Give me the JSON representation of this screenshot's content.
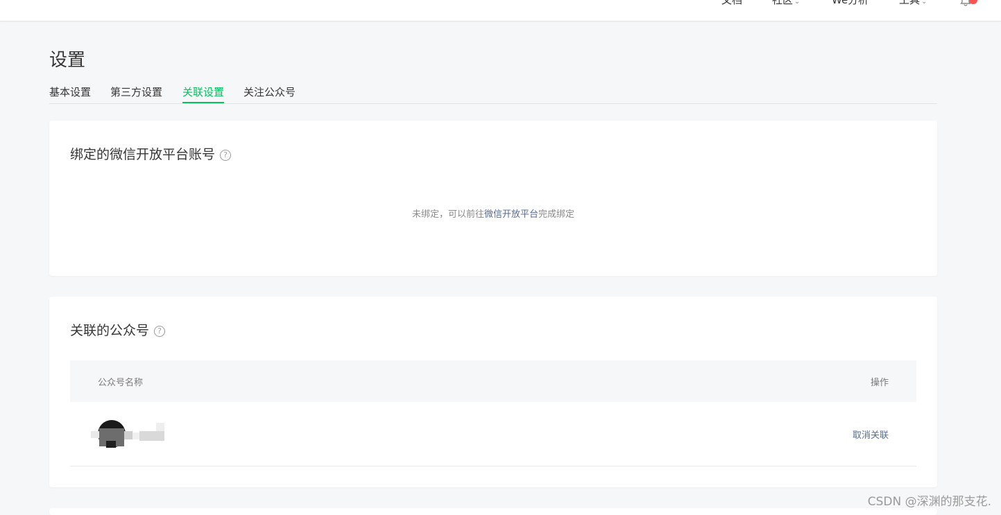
{
  "topnav": {
    "items": [
      {
        "label": "文档",
        "has_dropdown": false
      },
      {
        "label": "社区",
        "has_dropdown": true
      },
      {
        "label": "We分析",
        "has_dropdown": false
      },
      {
        "label": "工具",
        "has_dropdown": true
      }
    ],
    "dropdown_glyph": "⌄",
    "notification_icon": "bell-icon"
  },
  "page": {
    "title": "设置"
  },
  "tabs": [
    {
      "label": "基本设置",
      "active": false
    },
    {
      "label": "第三方设置",
      "active": false
    },
    {
      "label": "关联设置",
      "active": true
    },
    {
      "label": "关注公众号",
      "active": false
    }
  ],
  "open_platform_card": {
    "title": "绑定的微信开放平台账号",
    "help_glyph": "?",
    "note_prefix": "未绑定，可以前往",
    "note_link": "微信开放平台",
    "note_suffix": "完成绑定"
  },
  "official_accounts_card": {
    "title": "关联的公众号",
    "help_glyph": "?",
    "columns": {
      "name": "公众号名称",
      "action": "操作"
    },
    "rows": [
      {
        "action_label": "取消关联"
      }
    ]
  },
  "watermark": "CSDN @深渊的那支花.",
  "colors": {
    "accent_green": "#07c160",
    "link_blue": "#576b95",
    "notification_red": "#fa5151",
    "page_background": "#f6f7f9"
  }
}
